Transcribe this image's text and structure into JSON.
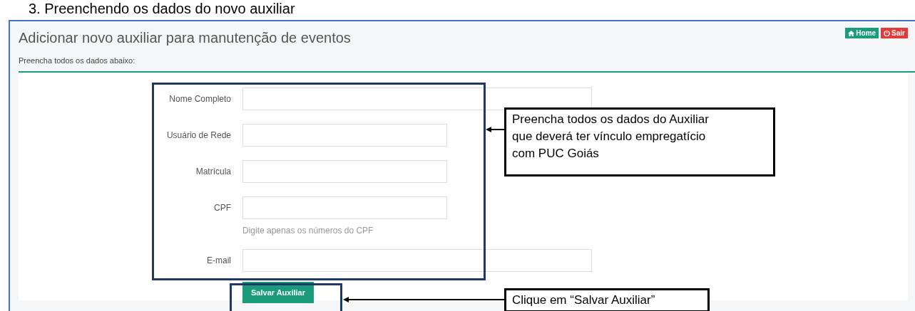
{
  "doc_heading": "3. Preenchendo os dados do novo auxiliar",
  "page": {
    "title": "Adicionar novo auxiliar para manutenção de eventos",
    "subtitle": "Preencha todos os dados abaixo:"
  },
  "nav_buttons": [
    {
      "label": "Home",
      "kind": "home"
    },
    {
      "label": "Sair",
      "kind": "logout"
    }
  ],
  "form": {
    "fields": [
      {
        "label": "Nome Completo"
      },
      {
        "label": "Usuário de Rede"
      },
      {
        "label": "Matrícula"
      },
      {
        "label": "CPF",
        "help": "Digite apenas os números do CPF"
      },
      {
        "label": "E-mail"
      }
    ],
    "submit": "Salvar Auxiliar"
  },
  "callouts": [
    {
      "text": "Preencha todos os dados do Auxiliar\nque deverá ter vínculo empregatício\ncom PUC Goiás"
    },
    {
      "text": "Clique em “Salvar Auxiliar”"
    }
  ]
}
